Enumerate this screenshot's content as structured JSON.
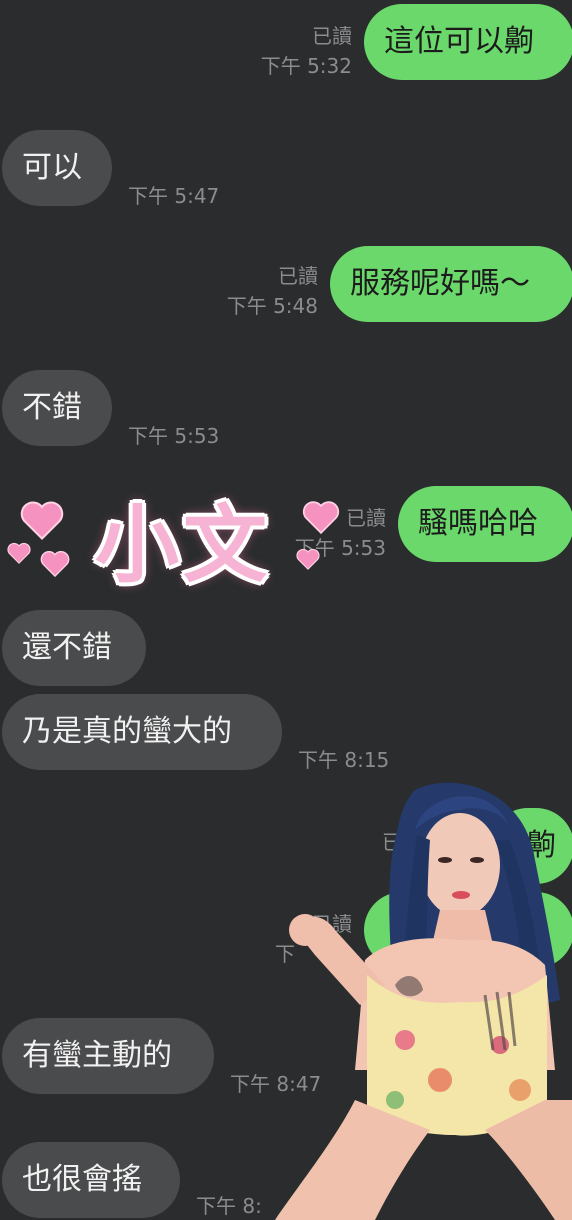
{
  "messages": [
    {
      "dir": "out",
      "text": "這位可以齁",
      "read": "已讀",
      "time": "下午 5:32"
    },
    {
      "dir": "in",
      "text": "可以",
      "time": "下午 5:47"
    },
    {
      "dir": "out",
      "text": "服務呢好嗎～",
      "read": "已讀",
      "time": "下午 5:48"
    },
    {
      "dir": "in",
      "text": "不錯",
      "time": "下午 5:53"
    },
    {
      "dir": "out",
      "text": "騷嗎哈哈",
      "read": "已讀",
      "time": "下午 5:53"
    },
    {
      "dir": "in",
      "text": "還不錯",
      "time": ""
    },
    {
      "dir": "in",
      "text": "乃是真的蠻大的",
      "time": "下午 8:15"
    },
    {
      "dir": "out",
      "text": "齁",
      "read": "已讀",
      "time": ""
    },
    {
      "dir": "out",
      "text": "",
      "read": "已讀",
      "time": "下"
    },
    {
      "dir": "in",
      "text": "有蠻主動的",
      "time": "下午 8:47"
    },
    {
      "dir": "in",
      "text": "也很會搖",
      "time": "下午 8:"
    }
  ],
  "sticker": {
    "title": "小文",
    "heart_color": "#f592c0"
  },
  "colors": {
    "background": "#2a2c2d",
    "outgoing": "#6bd86b",
    "incoming": "#4a4b4c",
    "meta": "#8b8c8d"
  }
}
